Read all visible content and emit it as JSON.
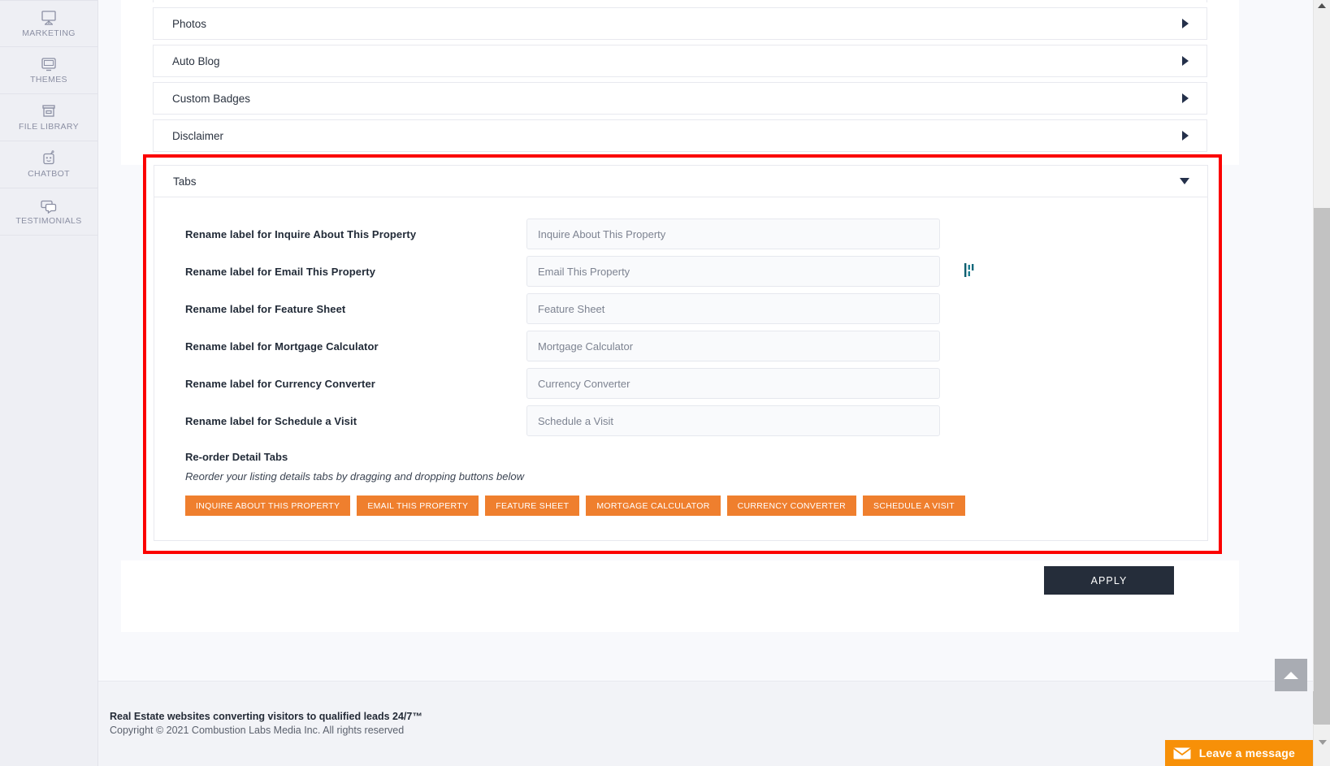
{
  "sidebar": {
    "items": [
      {
        "label": "MARKETING",
        "icon": "presentation-board-icon"
      },
      {
        "label": "THEMES",
        "icon": "monitor-icon"
      },
      {
        "label": "FILE LIBRARY",
        "icon": "file-box-icon"
      },
      {
        "label": "CHATBOT",
        "icon": "robot-icon"
      },
      {
        "label": "TESTIMONIALS",
        "icon": "speech-bubble-icon"
      }
    ]
  },
  "accordion": {
    "collapsed_rows": [
      {
        "title": "Photos",
        "chevron": "chevron-right-icon"
      },
      {
        "title": "Auto Blog",
        "chevron": "chevron-right-icon"
      },
      {
        "title": "Custom Badges",
        "chevron": "chevron-right-icon"
      },
      {
        "title": "Disclaimer",
        "chevron": "chevron-right-icon"
      }
    ],
    "expanded": {
      "title": "Tabs",
      "chevron": "chevron-down-icon"
    }
  },
  "tabs_panel": {
    "fields": [
      {
        "label": "Rename label for Inquire About This Property",
        "value": "Inquire About This Property"
      },
      {
        "label": "Rename label for Email This Property",
        "value": "Email This Property"
      },
      {
        "label": "Rename label for Feature Sheet",
        "value": "Feature Sheet"
      },
      {
        "label": "Rename label for Mortgage Calculator",
        "value": "Mortgage Calculator"
      },
      {
        "label": "Rename label for Currency Converter",
        "value": "Currency Converter"
      },
      {
        "label": "Rename label for Schedule a Visit",
        "value": "Schedule a Visit"
      }
    ],
    "reorder": {
      "title": "Re-order Detail Tabs",
      "subtitle": "Reorder your listing details tabs by dragging and dropping buttons below",
      "tags": [
        "INQUIRE ABOUT THIS PROPERTY",
        "EMAIL THIS PROPERTY",
        "FEATURE SHEET",
        "MORTGAGE CALCULATOR",
        "CURRENCY CONVERTER",
        "SCHEDULE A VISIT"
      ]
    }
  },
  "actions": {
    "apply_label": "APPLY"
  },
  "footer": {
    "tagline": "Real Estate websites converting visitors to qualified leads 24/7™",
    "copyright": "Copyright © 2021 Combustion Labs Media Inc. All rights reserved"
  },
  "chat": {
    "label": "Leave a message",
    "icon": "envelope-icon"
  },
  "scroll_top": {
    "icon": "caret-up-icon"
  },
  "cursor": {
    "icon": "text-ibeam-cursor"
  },
  "colors": {
    "highlight_border": "#fb0000",
    "tag_orange": "#ef7f2e",
    "apply_dark": "#252d3a",
    "chat_orange": "#f79008",
    "sidebar_bg": "#eeeff4",
    "page_bg": "#f8f9fc",
    "cursor_teal": "#0e5d6e"
  }
}
